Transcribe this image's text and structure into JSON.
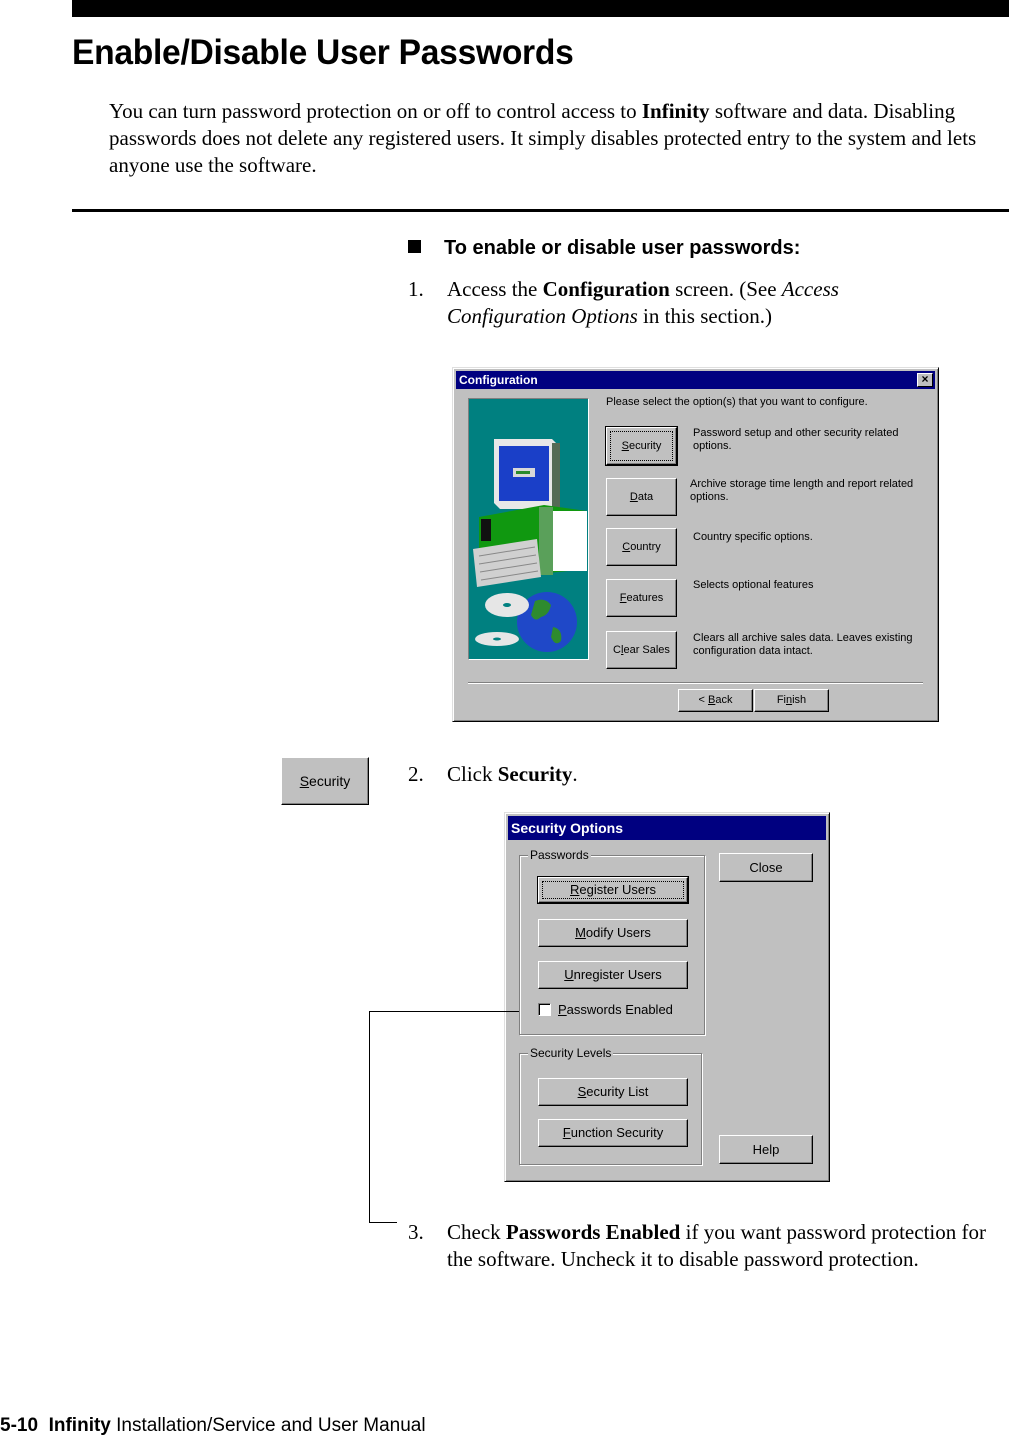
{
  "header": {
    "title": "Enable/Disable User Passwords",
    "intro_part1": "You can turn password protection on or off  to control access to ",
    "intro_bold": "Infinity",
    "intro_part2": " software and data. Disabling passwords does not delete any registered users. It simply disables protected entry to the system and lets anyone use the software."
  },
  "procedure": {
    "heading": "To enable or disable user passwords:",
    "steps": [
      {
        "num": "1.",
        "text1": "Access the ",
        "bold": "Configuration",
        "text2": " screen. (See ",
        "italic": "Access Configuration Options",
        "text3": " in this section.)"
      },
      {
        "num": "2.",
        "text1": "Click ",
        "bold": "Security",
        "text2": "."
      },
      {
        "num": "3.",
        "text1": "Check ",
        "bold": "Passwords Enabled",
        "text2": " if you want password protection for the software. Uncheck it to disable password protection."
      }
    ]
  },
  "config_dialog": {
    "title": "Configuration",
    "close_icon": "×",
    "prompt": "Please select the option(s) that you want to configure.",
    "options": [
      {
        "key": "S",
        "rest": "ecurity",
        "description": "Password setup and other security related options."
      },
      {
        "key": "D",
        "rest": "ata",
        "description": "Archive storage time length and report related options."
      },
      {
        "key": "C",
        "rest": "ountry",
        "description": "Country specific options."
      },
      {
        "key": "F",
        "rest": "eatures",
        "description": "Selects optional features"
      },
      {
        "pre": "C",
        "key": "l",
        "rest": "ear Sales",
        "description": "Clears all archive sales data.  Leaves existing configuration data intact."
      }
    ],
    "back": {
      "pre": "< ",
      "key": "B",
      "rest": "ack"
    },
    "finish": {
      "pre": "Fi",
      "key": "n",
      "rest": "ish"
    }
  },
  "sidebar_button": {
    "key": "S",
    "rest": "ecurity"
  },
  "security_dialog": {
    "title": "Security Options",
    "passwords_group": "Passwords",
    "register": {
      "key": "R",
      "rest": "egister Users"
    },
    "modify": {
      "key": "M",
      "rest": "odify Users"
    },
    "unregister": {
      "key": "U",
      "rest": "nregister Users"
    },
    "passwords_enabled": {
      "key": "P",
      "rest": "asswords Enabled",
      "checked": false
    },
    "levels_group": "Security Levels",
    "security_list": {
      "key": "S",
      "rest": "ecurity List"
    },
    "function_security": {
      "key": "F",
      "rest": "unction Security"
    },
    "close": "Close",
    "help": "Help"
  },
  "footer": {
    "page": "5-10",
    "product": "Infinity",
    "manual": "Installation/Service and User Manual"
  }
}
